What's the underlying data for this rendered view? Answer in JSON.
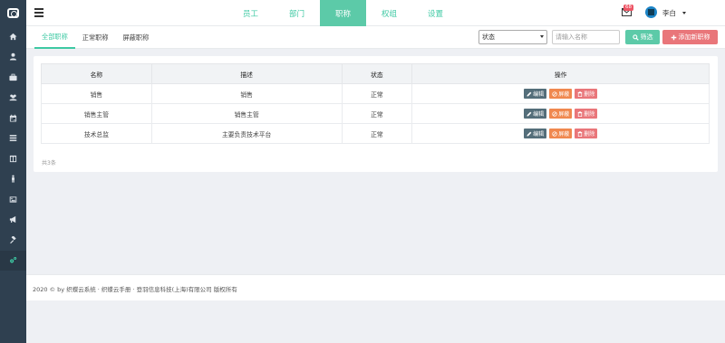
{
  "topnav": {
    "items": [
      {
        "label": "员工"
      },
      {
        "label": "部门"
      },
      {
        "label": "职称"
      },
      {
        "label": "权组"
      },
      {
        "label": "设置"
      }
    ],
    "mail_badge": "68",
    "username": "李白"
  },
  "subtabs": [
    {
      "label": "全部职称"
    },
    {
      "label": "正常职称"
    },
    {
      "label": "屏蔽职称"
    }
  ],
  "filters": {
    "status_value": "状态",
    "search_placeholder": "请输入名称",
    "filter_label": "筛选",
    "add_label": "添加新职称"
  },
  "table": {
    "headers": [
      "名称",
      "描述",
      "状态",
      "操作"
    ],
    "rows": [
      {
        "name": "销售",
        "desc": "销售",
        "status": "正常"
      },
      {
        "name": "销售主管",
        "desc": "销售主管",
        "status": "正常"
      },
      {
        "name": "技术总监",
        "desc": "主要负责技术平台",
        "status": "正常"
      }
    ],
    "actions": {
      "edit": "编辑",
      "block": "屏蔽",
      "delete": "删除"
    },
    "count": "共3条"
  },
  "footer": {
    "text": "2020 © by 织蝶云系统 · 织蝶云手册 · 登羽信息科技(上海)有限公司 版权所有"
  },
  "colors": {
    "accent": "#5ccaa8",
    "sidebar": "#2f4050",
    "danger": "#e9767a",
    "warning": "#f0884f"
  },
  "sidebar_icons": [
    "home-icon",
    "user-icon",
    "briefcase-icon",
    "users-icon",
    "calendar-icon",
    "list-icon",
    "columns-icon",
    "person-icon",
    "image-icon",
    "megaphone-icon",
    "gavel-icon",
    "cogs-icon"
  ]
}
